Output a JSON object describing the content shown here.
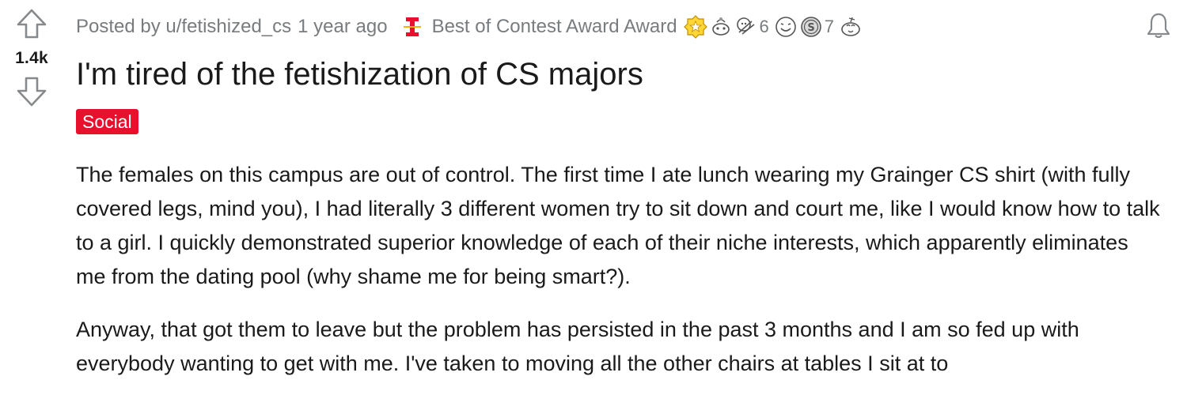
{
  "post": {
    "votes": "1.4k",
    "posted_by": "Posted by u/fetishized_cs",
    "time_ago": "1 year ago",
    "award_label": "Best of Contest Award Award",
    "award_count_a": "6",
    "award_count_b": "7",
    "title": "I'm tired of the fetishization of CS majors",
    "flair": "Social",
    "paragraphs": [
      "The females on this campus are out of control. The first time I ate lunch wearing my Grainger CS shirt (with fully covered legs, mind you), I had literally 3 different women try to sit down and court me, like I would know how to talk to a girl. I quickly demonstrated superior knowledge of each of their niche interests, which apparently eliminates me from the dating pool (why shame me for being smart?).",
      "Anyway, that got them to leave but the problem has persisted in the past 3 months and I am so fed up with everybody wanting to get with me. I've taken to moving all the other chairs at tables I sit at to"
    ]
  },
  "colors": {
    "flair_bg": "#e8112d",
    "meta_text": "#787c7e",
    "body_text": "#1a1a1b",
    "contest_icon": "#e8112d"
  },
  "icons": {
    "upvote": "upvote-arrow-icon",
    "downvote": "downvote-arrow-icon",
    "contest_award": "best-of-contest-award-icon",
    "bell": "notification-bell-icon"
  }
}
